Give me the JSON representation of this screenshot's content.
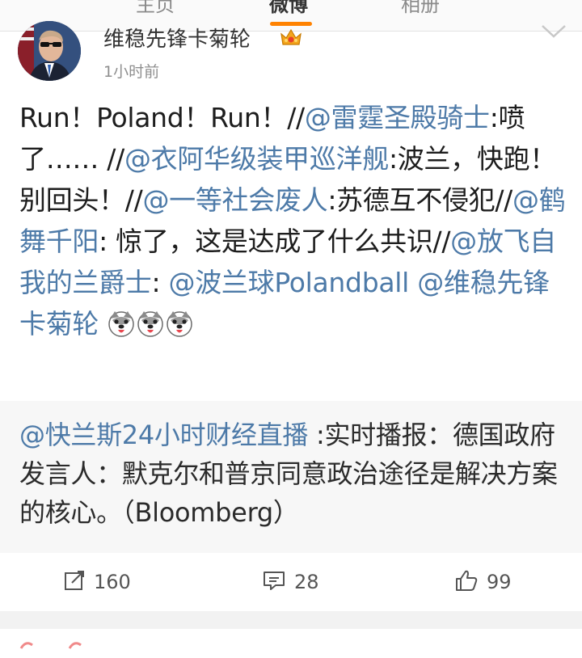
{
  "tabs": [
    "主页",
    "微博",
    "相册"
  ],
  "post": {
    "author": "维稳先锋卡菊轮",
    "time": "1小时前",
    "content": [
      {
        "t": "Run！Poland！Run！//",
        "m": false
      },
      {
        "t": "@雷霆圣殿骑士",
        "m": true
      },
      {
        "t": ":喷了…… //",
        "m": false
      },
      {
        "t": "@衣阿华级装甲巡洋舰",
        "m": true
      },
      {
        "t": ":波兰，快跑！别回头！//",
        "m": false
      },
      {
        "t": "@一等社会废人",
        "m": true
      },
      {
        "t": ":苏德互不侵犯//",
        "m": false
      },
      {
        "t": "@鹤舞千阳",
        "m": true
      },
      {
        "t": ": 惊了，这是达成了什么共识//",
        "m": false
      },
      {
        "t": "@放飞自我的兰爵士",
        "m": true
      },
      {
        "t": ": ",
        "m": false
      },
      {
        "t": "@波兰球Polandball",
        "m": true
      },
      {
        "t": " ",
        "m": false
      },
      {
        "t": "@维稳先锋卡菊轮",
        "m": true
      },
      {
        "t": " ",
        "m": false
      }
    ],
    "emoji_count": 3
  },
  "repost": {
    "mention": "@快兰斯24小时财经直播",
    "text": " :实时播报：德国政府发言人：默克尔和普京同意政治途径是解决方案的核心。（Bloomberg）"
  },
  "actions": {
    "repost_count": "160",
    "comment_count": "28",
    "like_count": "99"
  },
  "colors": {
    "mention": "#4d7aa8",
    "accent": "#ff8200"
  }
}
